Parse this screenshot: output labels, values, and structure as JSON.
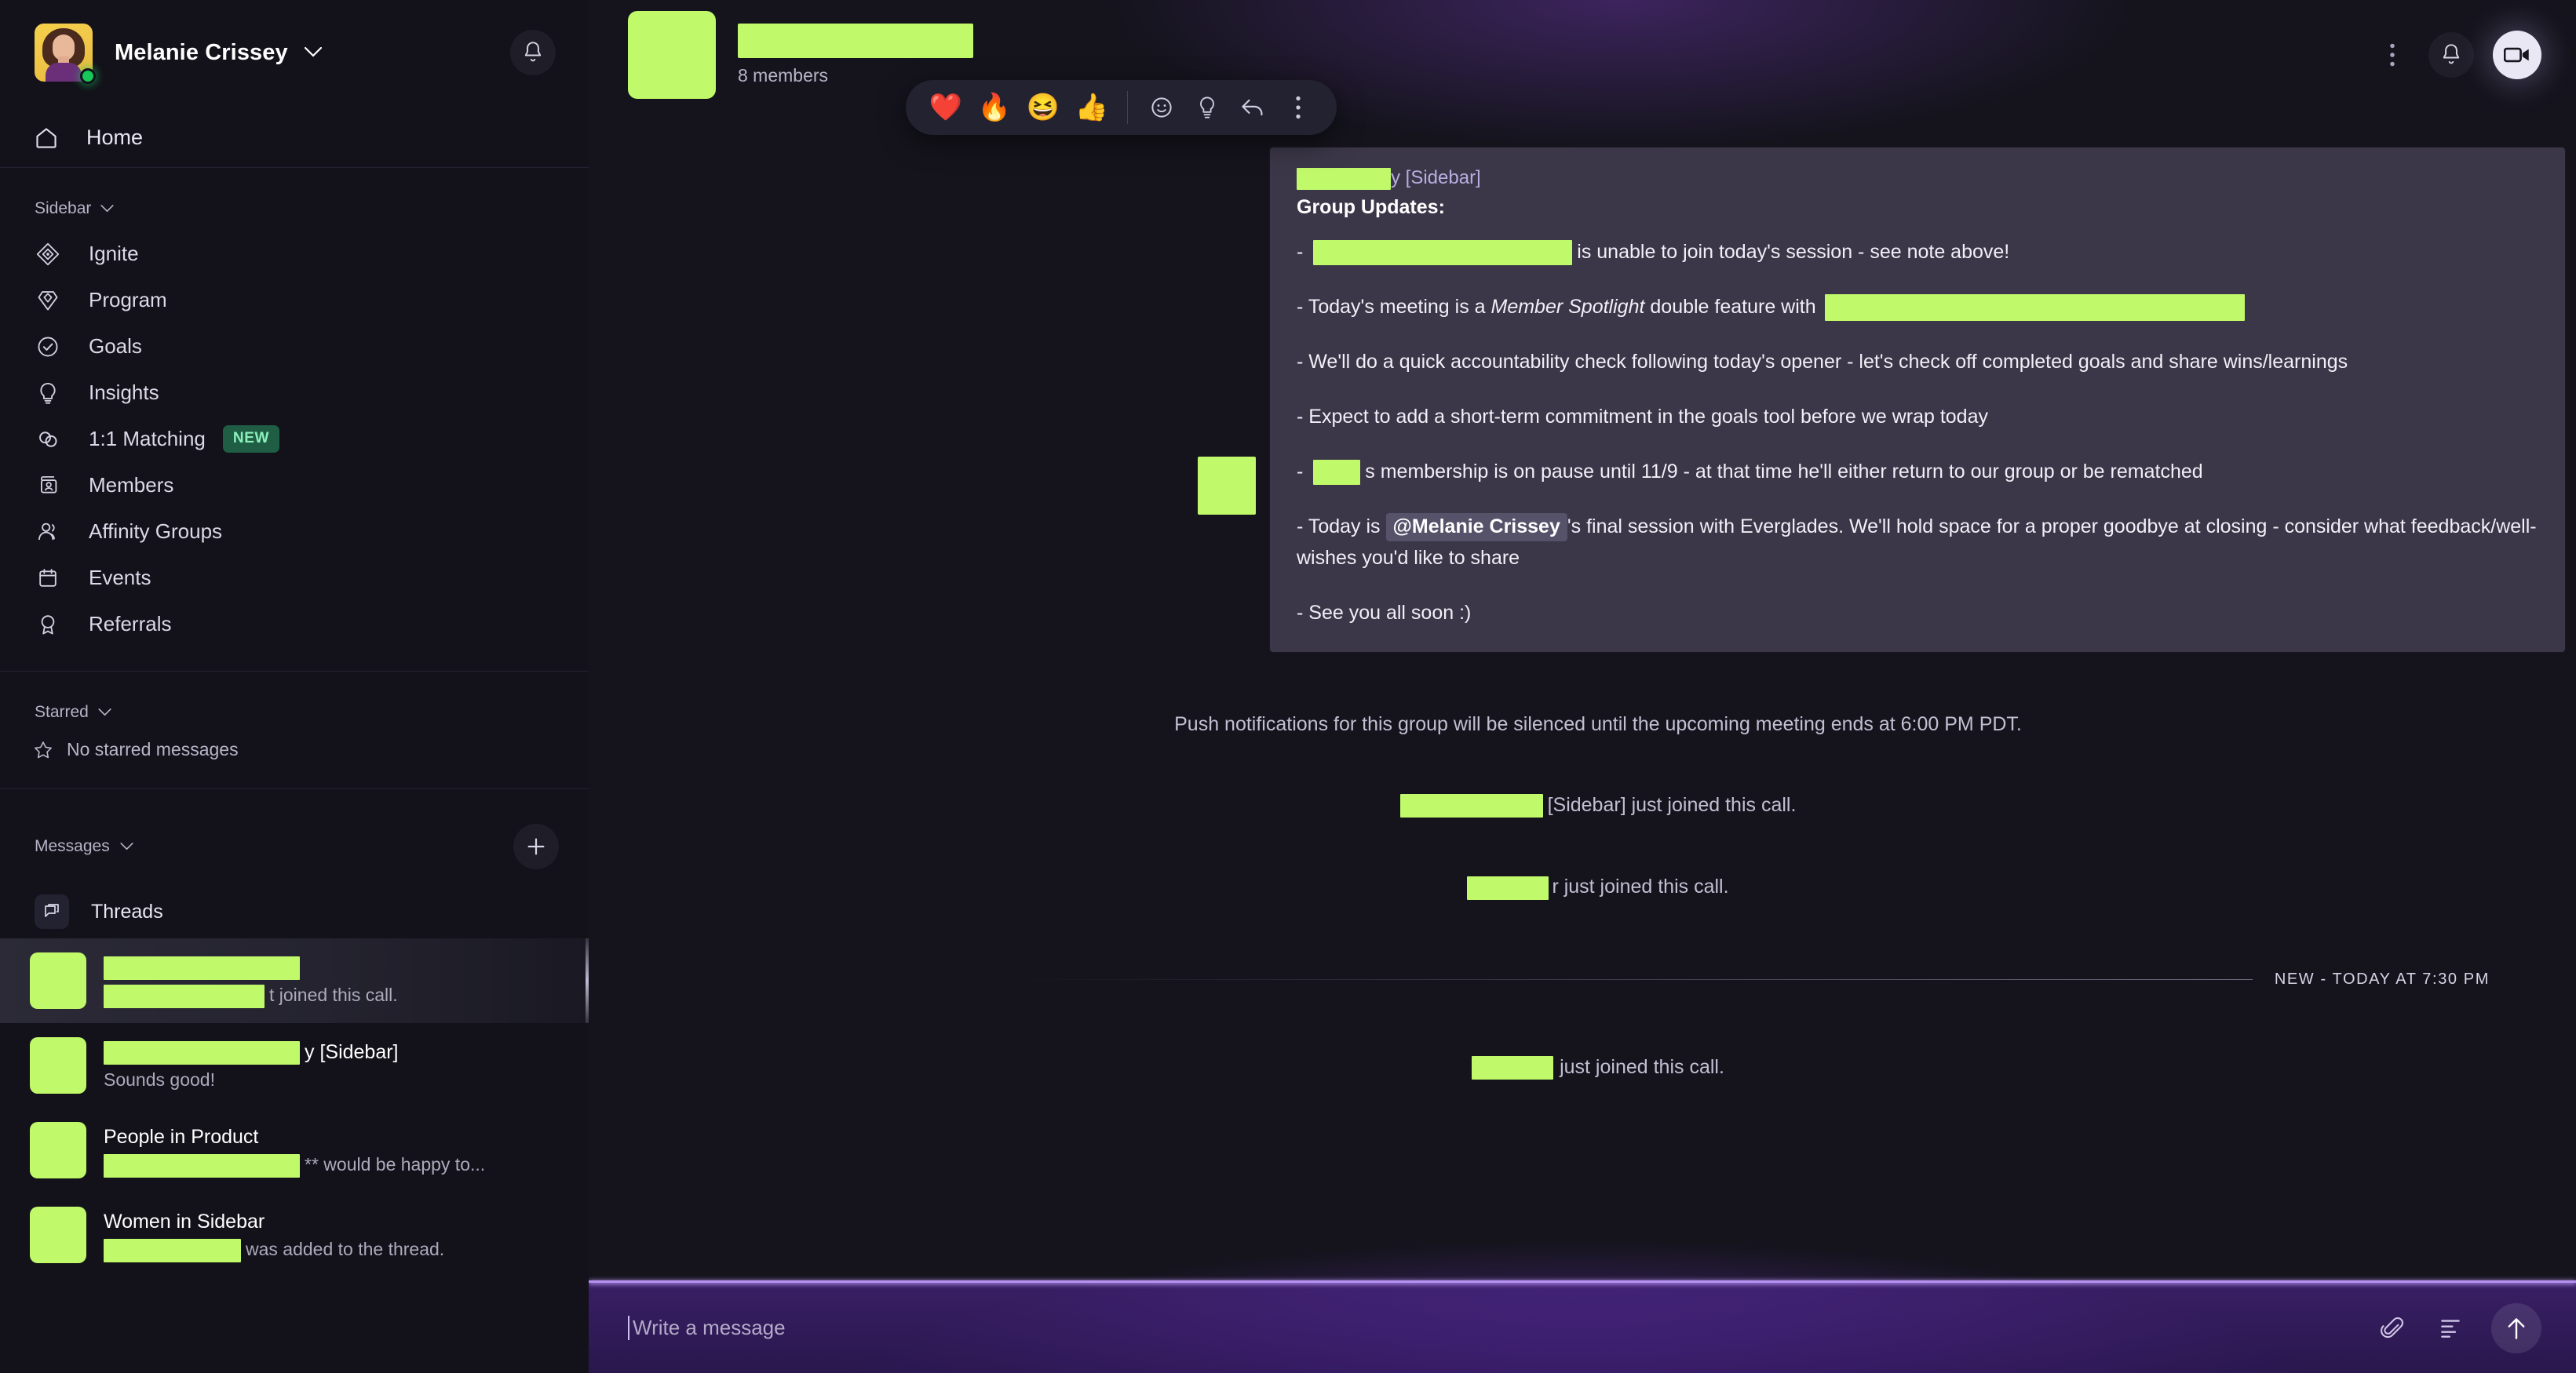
{
  "account": {
    "name": "Melanie Crissey",
    "status": "online",
    "avatar_alt": "avatar",
    "chevron_icon": "chevron-down-icon",
    "notifications_icon": "bell-icon"
  },
  "sidebar": {
    "home_label": "Home",
    "home_icon": "home-icon",
    "section_sidebar_label": "Sidebar",
    "section_starred_label": "Starred",
    "section_messages_label": "Messages",
    "nav_items": [
      {
        "label": "Ignite",
        "icon": "diamond-compass-icon",
        "badge": ""
      },
      {
        "label": "Program",
        "icon": "gem-icon",
        "badge": ""
      },
      {
        "label": "Goals",
        "icon": "check-circle-icon",
        "badge": ""
      },
      {
        "label": "Insights",
        "icon": "lightbulb-icon",
        "badge": ""
      },
      {
        "label": "1:1 Matching",
        "icon": "two-circles-icon",
        "badge": "NEW"
      },
      {
        "label": "Members",
        "icon": "id-card-icon",
        "badge": ""
      },
      {
        "label": "Affinity Groups",
        "icon": "people-icon",
        "badge": ""
      },
      {
        "label": "Events",
        "icon": "calendar-icon",
        "badge": ""
      },
      {
        "label": "Referrals",
        "icon": "award-icon",
        "badge": ""
      }
    ],
    "starred_empty_label": "No starred messages",
    "starred_empty_icon": "star-icon",
    "new_message_icon": "plus-icon",
    "threads_label": "Threads",
    "threads_icon": "threads-icon",
    "conversations": [
      {
        "title_suffix": "",
        "title_redacted": true,
        "preview_suffix": "t joined this call.",
        "preview_redacted": true,
        "selected": true
      },
      {
        "title_suffix": "y [Sidebar]",
        "title_redacted": true,
        "preview_suffix": "Sounds good!",
        "preview_redacted": false,
        "selected": false
      },
      {
        "title_suffix": "People in Product",
        "title_redacted": false,
        "preview_suffix": "** would be happy to...",
        "preview_redacted": true,
        "selected": false
      },
      {
        "title_suffix": "Women in Sidebar",
        "title_redacted": false,
        "preview_suffix": "was added to the thread.",
        "preview_redacted": true,
        "selected": false
      }
    ]
  },
  "chat_header": {
    "title_redacted": true,
    "member_count": "8 members",
    "more_icon": "more-vertical-icon",
    "bell_icon": "bell-icon",
    "video_icon": "video-camera-icon"
  },
  "reaction_bar": {
    "emojis": [
      "❤️",
      "🔥",
      "😆",
      "👍"
    ],
    "emoji_picker_icon": "smiley-face-icon",
    "lightbulb_icon": "lightbulb-icon",
    "reply_icon": "reply-arrow-icon",
    "more_icon": "more-vertical-icon"
  },
  "message": {
    "author_suffix": "y [Sidebar]",
    "heading": "Group Updates:",
    "lines": [
      {
        "prefix": "- ",
        "redact_before": true,
        "text": "is unable to join today's session - see note above!",
        "redact_after": false
      },
      {
        "prefix": "- ",
        "redact_before": false,
        "text": "Today's meeting is a ",
        "italic": "Member Spotlight",
        "text2": " double feature with ",
        "redact_after": true
      },
      {
        "prefix": "- ",
        "redact_before": false,
        "text": "We'll do a quick accountability check following today's opener - let's check off completed goals and share wins/learnings",
        "redact_after": false
      },
      {
        "prefix": "- ",
        "redact_before": false,
        "text": "Expect to add a short-term commitment in the goals tool before we wrap today",
        "redact_after": false
      },
      {
        "prefix": "- ",
        "redact_before": true,
        "text": "s membership is on pause until 11/9 - at that time he'll either return to our group or be rematched",
        "redact_after": false
      },
      {
        "prefix": "- ",
        "redact_before": false,
        "text": "Today is ",
        "mention": "@Melanie Crissey",
        "text2": "'s  final session with Everglades. We'll hold space for a proper goodbye at closing - consider what feedback/well-wishes you'd like to share",
        "redact_after": false
      },
      {
        "prefix": "- ",
        "redact_before": false,
        "text": "See you all soon :)",
        "redact_after": false
      }
    ]
  },
  "system_messages": [
    {
      "type": "note",
      "text": "Push notifications for this group will be silenced until the upcoming meeting ends at 6:00 PM PDT.",
      "redacted": false
    },
    {
      "type": "join",
      "text": "[Sidebar] just joined this call.",
      "redacted": true
    },
    {
      "type": "join",
      "text": "r just joined this call.",
      "redacted": true
    }
  ],
  "new_divider": {
    "label": "NEW - TODAY AT 7:30 PM"
  },
  "system_messages_after": [
    {
      "type": "join",
      "text": "just joined this call.",
      "redacted": true
    }
  ],
  "composer": {
    "placeholder": "Write a message",
    "value": "",
    "attach_icon": "paperclip-icon",
    "format_icon": "text-format-icon",
    "send_icon": "arrow-up-icon"
  },
  "colors": {
    "redaction": "#c0f96a",
    "accent_purple": "#b18cf0",
    "badge_new_bg": "#1f5e44",
    "badge_new_text": "#8df0bc",
    "bubble_bg": "#3b3748",
    "sidebar_bg": "#13121a"
  }
}
